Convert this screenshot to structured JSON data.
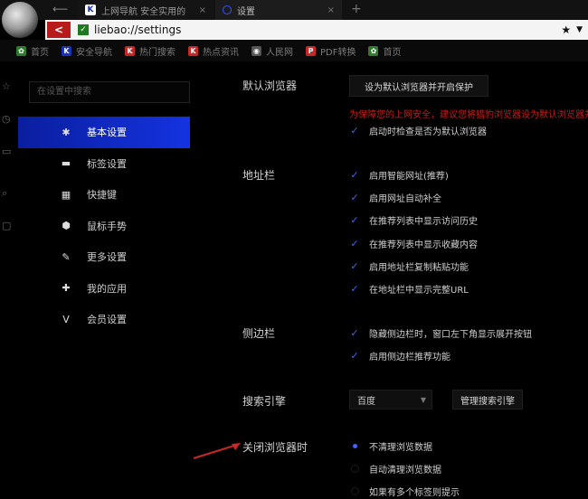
{
  "tabs": [
    {
      "title": "上网导航 安全实用的",
      "icon": "K"
    },
    {
      "title": "设置",
      "icon": ""
    }
  ],
  "address": {
    "url": "liebao://settings"
  },
  "bookmarks": [
    {
      "label": "首页",
      "icon": "leaf",
      "color": "#2f7b2f"
    },
    {
      "label": "安全导航",
      "icon": "K",
      "color": "#1a33b8"
    },
    {
      "label": "热门搜索",
      "icon": "K",
      "color": "#c62828"
    },
    {
      "label": "热点资讯",
      "icon": "K",
      "color": "#c62828"
    },
    {
      "label": "人民网",
      "icon": "globe",
      "color": "#555555"
    },
    {
      "label": "PDF转换",
      "icon": "PDF",
      "color": "#c62828"
    },
    {
      "label": "首页",
      "icon": "leaf",
      "color": "#2f7b2f"
    }
  ],
  "search": {
    "placeholder": "在设置中搜索"
  },
  "nav": [
    {
      "label": "基本设置",
      "icon": "gear-icon"
    },
    {
      "label": "标签设置",
      "icon": "monitor-icon"
    },
    {
      "label": "快捷键",
      "icon": "keyboard-icon"
    },
    {
      "label": "鼠标手势",
      "icon": "mouse-icon"
    },
    {
      "label": "更多设置",
      "icon": "wrench-icon"
    },
    {
      "label": "我的应用",
      "icon": "puzzle-icon"
    },
    {
      "label": "会员设置",
      "icon": "vip-icon"
    }
  ],
  "sections": {
    "default_browser": {
      "label": "默认浏览器",
      "button": "设为默认浏览器并开启保护",
      "warning": "为保障您的上网安全，建议您将猎豹浏览器设为默认浏览器并开启保护",
      "options": [
        "启动时检查是否为默认浏览器"
      ]
    },
    "address_bar": {
      "label": "地址栏",
      "options": [
        "启用智能网址(推荐)",
        "启用网址自动补全",
        "在推荐列表中显示访问历史",
        "在推荐列表中显示收藏内容",
        "启用地址栏复制粘贴功能",
        "在地址栏中显示完整URL"
      ]
    },
    "sidebar": {
      "label": "侧边栏",
      "options": [
        "隐藏侧边栏时，窗口左下角显示展开按钮",
        "启用侧边栏推荐功能"
      ]
    },
    "search_engine": {
      "label": "搜索引擎",
      "selected": "百度",
      "manage_button": "管理搜索引擎"
    },
    "on_close": {
      "label": "关闭浏览器时",
      "options": [
        "不清理浏览数据",
        "自动清理浏览数据",
        "如果有多个标签则提示"
      ],
      "selected_index": 0
    }
  },
  "colors": {
    "accent": "#1433e0",
    "warning": "#c21f1f",
    "annotation_arrow": "#c62828"
  }
}
